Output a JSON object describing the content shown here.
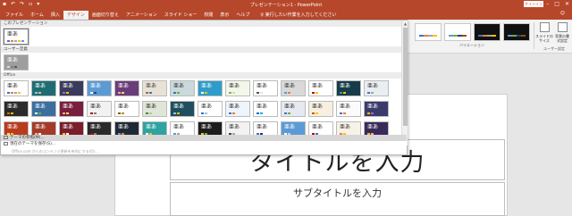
{
  "titlebar": {
    "title": "プレゼンテーション1 - PowerPoint",
    "signin_label": "サインイン",
    "qat_icons": [
      "save-icon",
      "undo-icon",
      "redo-icon",
      "start-slideshow-icon",
      "customize-icon"
    ],
    "window_controls": [
      "minimize-icon",
      "restore-icon",
      "close-icon"
    ]
  },
  "tabs": [
    {
      "label": "ファイル"
    },
    {
      "label": "ホーム"
    },
    {
      "label": "挿入"
    },
    {
      "label": "デザイン",
      "active": true
    },
    {
      "label": "画面切り替え"
    },
    {
      "label": "アニメーション"
    },
    {
      "label": "スライド ショー"
    },
    {
      "label": "校閲"
    },
    {
      "label": "表示"
    },
    {
      "label": "ヘルプ"
    }
  ],
  "tellme": "実行したい作業を入力してください",
  "ribbon": {
    "variants_label": "バリエーション",
    "slide_size_label": "スライドの サイズ",
    "format_bg_label": "背景の書 式設定",
    "user_design_label": "ユーザー設定"
  },
  "gallery": {
    "sections": {
      "this_presentation": "このプレゼンテーション",
      "user_defined": "ユーザー定義",
      "office": "Office"
    },
    "thumb_text": "亜あ",
    "office_note": "Office.com からのコンテンツ更新を有効にする(O)...",
    "browse_label": "テーマの参照(M)...",
    "save_label": "現在のテーマを保存(S)..."
  },
  "slide": {
    "title_placeholder": "タイトルを入力",
    "subtitle_placeholder": "サブタイトルを入力"
  },
  "colors": {
    "accent": "#b7472a",
    "ribbon_bg": "#f3f3f3"
  }
}
